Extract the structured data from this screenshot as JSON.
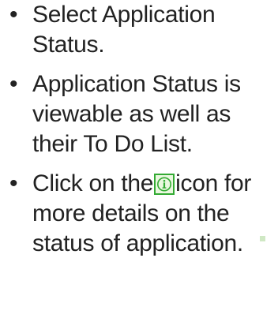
{
  "bullets": [
    {
      "parts": {
        "text": "Select Application Status."
      }
    },
    {
      "parts": {
        "text": "Application Status is viewable as well as their To Do List."
      }
    },
    {
      "parts": {
        "before": "Click on the",
        "icon": "info-icon",
        "after": "icon for more details on the status of application."
      }
    }
  ],
  "bullet_glyph": "•",
  "colors": {
    "text": "#222222",
    "icon_border": "#33aa33",
    "icon_fill": "#eaf8df"
  }
}
